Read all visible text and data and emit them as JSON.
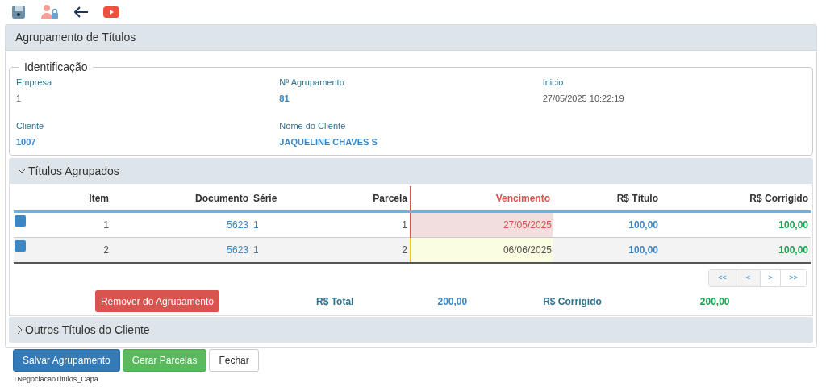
{
  "toolbar": [
    {
      "kind": "save"
    },
    {
      "kind": "user-lock"
    },
    {
      "kind": "back"
    },
    {
      "kind": "video"
    }
  ],
  "panel": {
    "title": "Agrupamento de Títulos"
  },
  "identificacao": {
    "legend": "Identificação",
    "fields": [
      {
        "label": "Empresa",
        "value": "1",
        "emphasis": false
      },
      {
        "label": "Nº Agrupamento",
        "value": "81",
        "emphasis": true
      },
      {
        "label": "Inicio",
        "value": "27/05/2025 10:22:19",
        "emphasis": false
      },
      {
        "label": "Cliente",
        "value": "1007",
        "emphasis": true
      },
      {
        "label": "Nome do Cliente",
        "value": "JAQUELINE CHAVES S",
        "emphasis": true
      }
    ]
  },
  "titulos_agrupados": {
    "title": "Títulos Agrupados",
    "expanded": true,
    "columns": [
      "Item",
      "Documento",
      "Série",
      "Parcela",
      "Vencimento",
      "R$ Título",
      "R$ Corrigido"
    ],
    "rows": [
      {
        "checked": true,
        "item": "1",
        "documento": "5623",
        "serie": "1",
        "parcela": "1",
        "vencimento": "27/05/2025",
        "kind": "overdue",
        "titulo": "100,00",
        "corrigido": "100,00"
      },
      {
        "checked": true,
        "item": "2",
        "documento": "5623",
        "serie": "1",
        "parcela": "2",
        "vencimento": "06/06/2025",
        "kind": "pending",
        "titulo": "100,00",
        "corrigido": "100,00"
      }
    ],
    "pager": [
      "<<",
      "<",
      ">",
      ">>"
    ],
    "remove_button": "Remover do Agrupamento",
    "total_label": "R$ Total",
    "total": "200,00",
    "corrigido_label": "R$ Corrigido",
    "corrigido_total": "200,00"
  },
  "outros_titulos": {
    "title": "Outros Títulos do Cliente",
    "expanded": false
  },
  "buttons": [
    {
      "label": "Salvar Agrupamento",
      "kind": "primary"
    },
    {
      "label": "Gerar Parcelas",
      "kind": "success"
    },
    {
      "label": "Fechar",
      "kind": "default"
    }
  ],
  "form_name": "TNegociacaoTitulos_Capa"
}
